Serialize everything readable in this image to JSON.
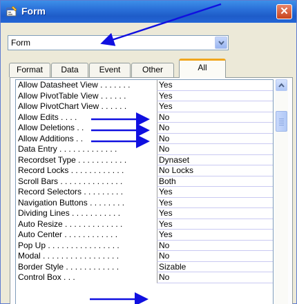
{
  "window": {
    "title": "Form",
    "close_label": "✕"
  },
  "selector": {
    "value": "Form"
  },
  "tabs": [
    {
      "label": "Format"
    },
    {
      "label": "Data"
    },
    {
      "label": "Event"
    },
    {
      "label": "Other"
    },
    {
      "label": "All",
      "active": true
    }
  ],
  "properties": [
    {
      "name": "Allow Datasheet View . . . . . . .",
      "value": "Yes"
    },
    {
      "name": "Allow PivotTable View . . . . . .",
      "value": "Yes"
    },
    {
      "name": "Allow PivotChart View . . . . . .",
      "value": "Yes"
    },
    {
      "name": "Allow Edits . . . .",
      "value": "No"
    },
    {
      "name": "Allow Deletions . .",
      "value": "No"
    },
    {
      "name": "Allow Additions . .",
      "value": "No"
    },
    {
      "name": "Data Entry . . . . . . . . . . . . .",
      "value": "No"
    },
    {
      "name": "Recordset Type . . . . . . . . . . .",
      "value": "Dynaset"
    },
    {
      "name": "Record Locks . . . . . . . . . . . .",
      "value": "No Locks"
    },
    {
      "name": "Scroll Bars . . . . . . . . . . . . . .",
      "value": "Both"
    },
    {
      "name": "Record Selectors . . . . . . . . .",
      "value": "Yes"
    },
    {
      "name": "Navigation Buttons . . . . . . . .",
      "value": "Yes"
    },
    {
      "name": "Dividing Lines . . . . . . . . . . .",
      "value": "Yes"
    },
    {
      "name": "Auto Resize . . . . . . . . . . . . .",
      "value": "Yes"
    },
    {
      "name": "Auto Center . . . . . . . . . . . .",
      "value": "Yes"
    },
    {
      "name": "Pop Up . . . . . . . . . . . . . . . .",
      "value": "No"
    },
    {
      "name": "Modal . . . . . . . . . . . . . . . . .",
      "value": "No"
    },
    {
      "name": "Border Style . . . . . . . . . . . .",
      "value": "Sizable"
    },
    {
      "name": "Control Box . . .",
      "value": "No"
    }
  ],
  "annotations": {
    "arrow_color": "#1010e0"
  },
  "colors": {
    "titlebar": "#2a6fd8",
    "active_tab_accent": "#f0a61d",
    "grid_divider": "#c9c9f2"
  }
}
